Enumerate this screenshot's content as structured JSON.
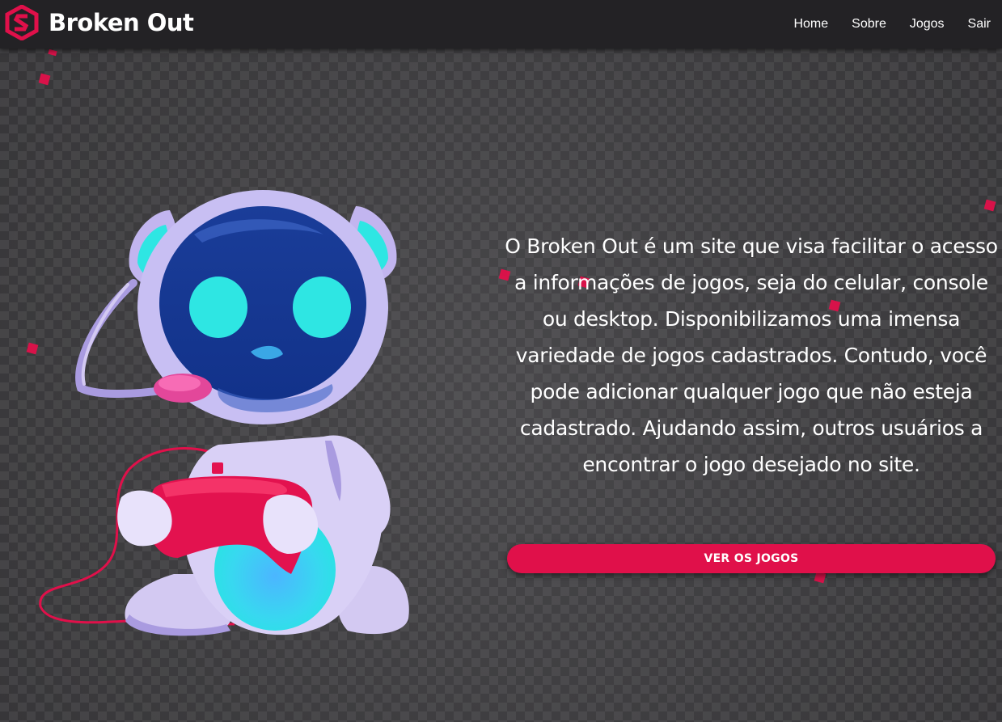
{
  "header": {
    "brand_name": "Broken Out",
    "logo_icon": "broken-out-logo-icon",
    "nav": [
      {
        "label": "Home"
      },
      {
        "label": "Sobre"
      },
      {
        "label": "Jogos"
      },
      {
        "label": "Sair"
      }
    ]
  },
  "hero": {
    "description": "O Broken Out é um site que visa facilitar o acesso a informações de jogos, seja do celular, console ou desktop. Disponibilizamos uma imensa variedade de jogos cadastrados. Contudo, você pode adicionar qualquer jogo que não esteja cadastrado. Ajudando assim, outros usuários a encontrar o jogo desejado no site.",
    "cta_label": "VER OS JOGOS",
    "illustration": "gamer-robot-illustration"
  },
  "colors": {
    "accent": "#e0104a",
    "navbar": "#232225",
    "background": "#3f3e41",
    "text": "#ffffff"
  }
}
